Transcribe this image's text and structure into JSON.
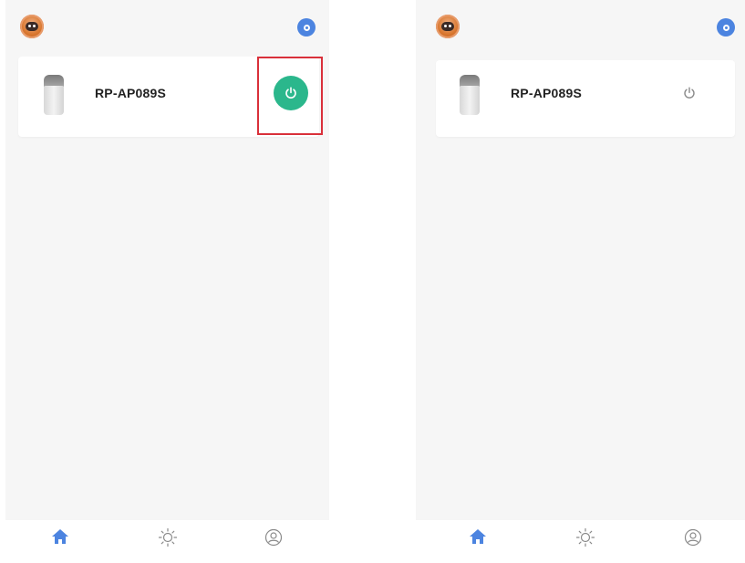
{
  "screens": [
    {
      "device": {
        "name": "RP-AP089S",
        "power_state": "on",
        "power_icon": "power-icon",
        "highlighted": true
      },
      "tabs": [
        {
          "label": "",
          "icon": "home-icon",
          "active": true
        },
        {
          "label": "",
          "icon": "sun-icon",
          "active": false
        },
        {
          "label": "",
          "icon": "user-icon",
          "active": false
        }
      ]
    },
    {
      "device": {
        "name": "RP-AP089S",
        "power_state": "off",
        "power_icon": "power-icon",
        "highlighted": false
      },
      "tabs": [
        {
          "label": "",
          "icon": "home-icon",
          "active": true
        },
        {
          "label": "",
          "icon": "sun-icon",
          "active": false
        },
        {
          "label": "",
          "icon": "user-icon",
          "active": false
        }
      ]
    }
  ],
  "colors": {
    "accent": "#4c84e0",
    "power_on": "#2bb78c",
    "highlight": "#d9303a",
    "background": "#f6f6f6"
  }
}
